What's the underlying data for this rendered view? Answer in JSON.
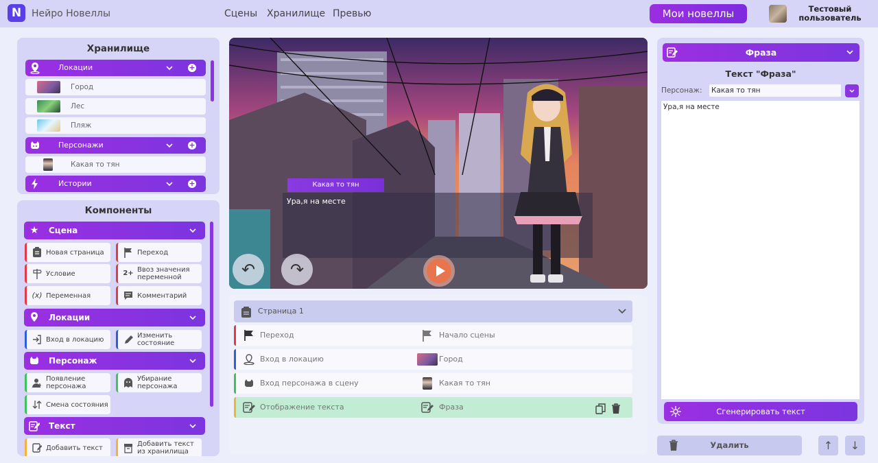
{
  "app": {
    "logo_letter": "N",
    "name": "Нейро Новеллы"
  },
  "nav": {
    "items": [
      "Сцены",
      "Хранилище",
      "Превью"
    ],
    "my_novels": "Мои новеллы"
  },
  "user": {
    "name": "Тестовый пользователь"
  },
  "storage": {
    "title": "Хранилище",
    "groups": [
      {
        "label": "Локации",
        "icon": "location-pin-icon",
        "items": [
          "Город",
          "Лес",
          "Пляж"
        ]
      },
      {
        "label": "Персонажи",
        "icon": "character-mask-icon",
        "items": [
          "Какая то тян"
        ]
      },
      {
        "label": "Истории",
        "icon": "lightning-icon",
        "items": []
      }
    ]
  },
  "components": {
    "title": "Компоненты",
    "groups": [
      {
        "label": "Сцена",
        "items": [
          "Новая страница",
          "Переход",
          "Условие",
          "Ввоз значения переменной",
          "Переменная",
          "Комментарий"
        ]
      },
      {
        "label": "Локации",
        "items": [
          "Вход в локацию",
          "Изменить состояние"
        ]
      },
      {
        "label": "Персонаж",
        "items": [
          "Появление персонажа",
          "Убирание персонажа",
          "Смена состояния"
        ]
      },
      {
        "label": "Текст",
        "items": [
          "Добавить текст",
          "Добавить текст из хранилища"
        ]
      }
    ]
  },
  "preview": {
    "speaker": "Какая то тян",
    "dialog": "Ура,я на месте",
    "undo": "↶",
    "redo": "↷"
  },
  "page": {
    "header": "Страница 1",
    "rows": [
      {
        "label": "Переход",
        "value": "Начало сцены",
        "accent": "#e23a4a"
      },
      {
        "label": "Вход в локацию",
        "value": "Город",
        "accent": "#2f5fd8"
      },
      {
        "label": "Вход персонажа в сцену",
        "value": "Какая то тян",
        "accent": "#3cc45a"
      },
      {
        "label": "Отображение текста",
        "value": "Фраза",
        "accent": "#f3b33a"
      }
    ]
  },
  "phrase": {
    "header": "Фраза",
    "title": "Текст \"Фраза\"",
    "character_label": "Персонаж:",
    "character_value": "Какая то тян",
    "text": "Ура,я на месте",
    "generate": "Сгенерировать текст"
  },
  "actions": {
    "delete": "Удалить"
  },
  "colors": {
    "accent": "#8b35e0",
    "brand": "#5a3ee8",
    "highlight_row": "#c2ecd4"
  }
}
